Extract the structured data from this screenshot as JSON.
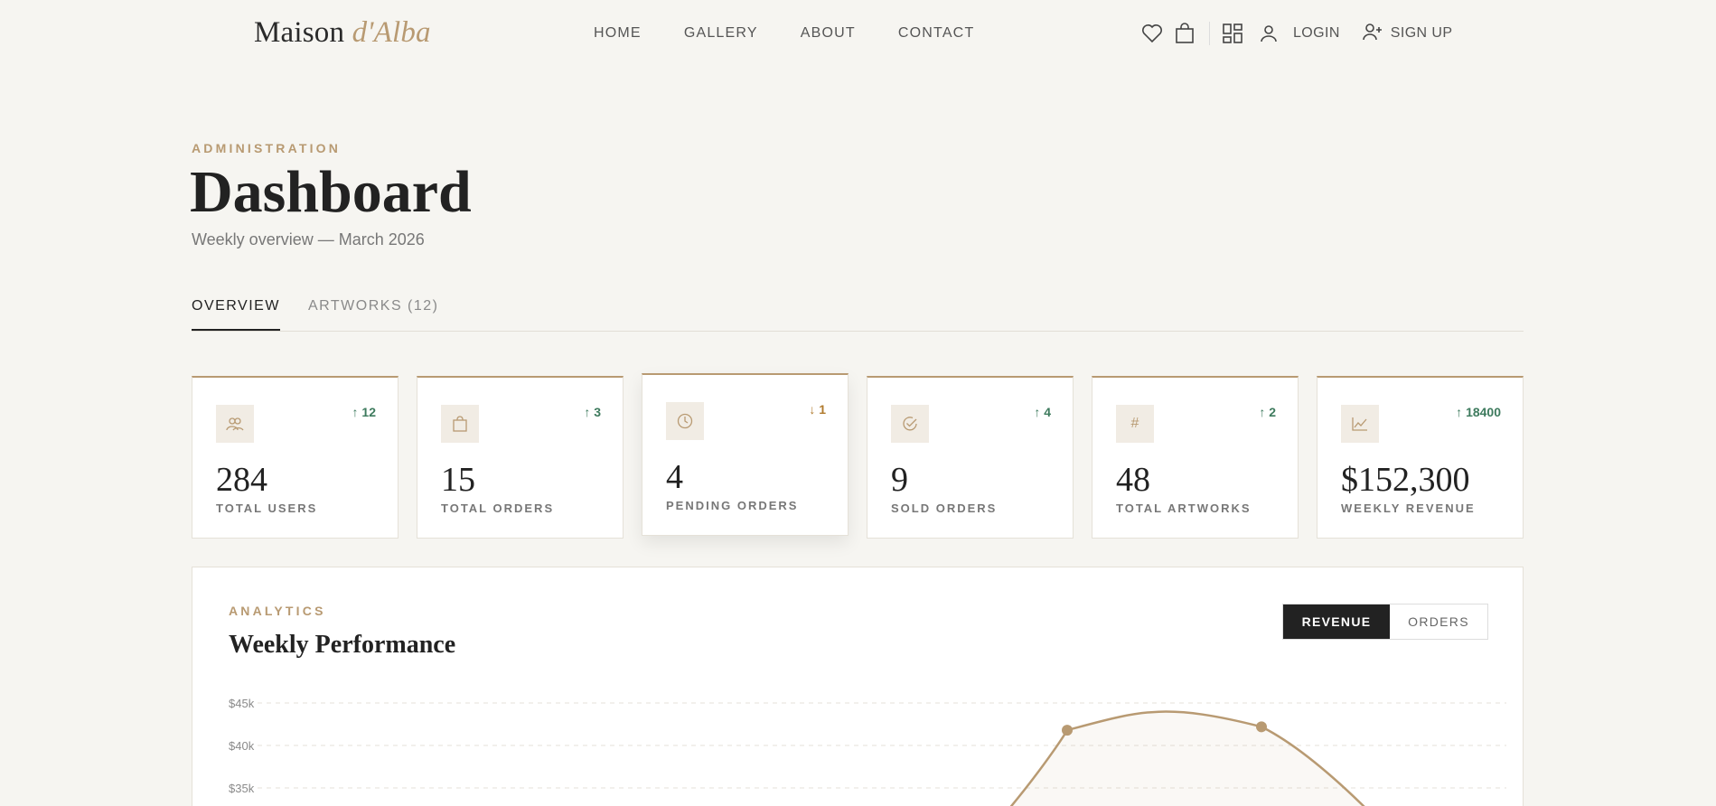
{
  "header": {
    "logo_main": "Maison",
    "logo_accent": "d'Alba",
    "nav": [
      "HOME",
      "GALLERY",
      "ABOUT",
      "CONTACT"
    ],
    "login": "LOGIN",
    "signup": "SIGN UP"
  },
  "page": {
    "eyebrow": "ADMINISTRATION",
    "title": "Dashboard",
    "subtitle": "Weekly overview — March 2026"
  },
  "tabs": [
    "OVERVIEW",
    "ARTWORKS (12)"
  ],
  "stats": [
    {
      "icon": "users-icon",
      "delta": "12",
      "direction": "up",
      "value": "284",
      "label": "TOTAL USERS"
    },
    {
      "icon": "bag-icon",
      "delta": "3",
      "direction": "up",
      "value": "15",
      "label": "TOTAL ORDERS"
    },
    {
      "icon": "clock-icon",
      "delta": "1",
      "direction": "down",
      "value": "4",
      "label": "PENDING ORDERS"
    },
    {
      "icon": "check-circle-icon",
      "delta": "4",
      "direction": "up",
      "value": "9",
      "label": "SOLD ORDERS"
    },
    {
      "icon": "hash-icon",
      "delta": "2",
      "direction": "up",
      "value": "48",
      "label": "TOTAL ARTWORKS"
    },
    {
      "icon": "chart-line-icon",
      "delta": "18400",
      "direction": "up",
      "value": "$152,300",
      "label": "WEEKLY REVENUE"
    }
  ],
  "analytics": {
    "eyebrow": "ANALYTICS",
    "title": "Weekly Performance",
    "toggle_active": "REVENUE",
    "toggle_inactive": "ORDERS"
  },
  "colors": {
    "accent": "#b89a72",
    "up": "#3d7a5d",
    "down": "#b07a2d",
    "dark": "#222222"
  },
  "chart_data": {
    "type": "line",
    "ylabel": "",
    "yticks": [
      "$45k",
      "$40k",
      "$35k"
    ],
    "ylim": [
      35000,
      45000
    ],
    "series": [
      {
        "values": [
          41800,
          43000,
          42200,
          41800
        ]
      }
    ]
  }
}
